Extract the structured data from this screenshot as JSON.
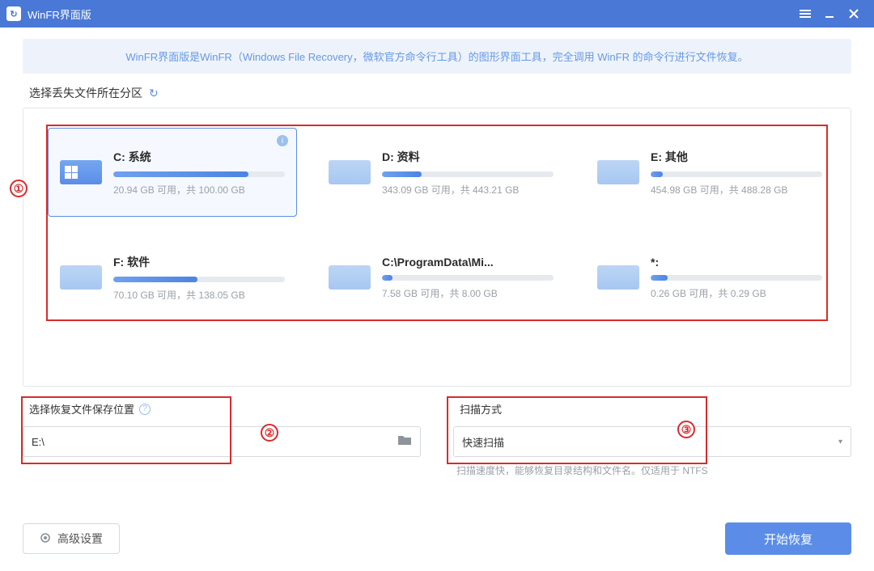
{
  "titlebar": {
    "app_name": "WinFR界面版"
  },
  "banner": {
    "text": "WinFR界面版是WinFR（Windows File Recovery，微软官方命令行工具）的图形界面工具，完全调用 WinFR 的命令行进行文件恢复。"
  },
  "section": {
    "select_partition_label": "选择丢失文件所在分区"
  },
  "drives": [
    {
      "name": "C: 系统",
      "stats": "20.94 GB 可用，共 100.00 GB",
      "fill_pct": 79,
      "selected": true,
      "system": true
    },
    {
      "name": "D: 资料",
      "stats": "343.09 GB 可用，共 443.21 GB",
      "fill_pct": 23,
      "selected": false,
      "system": false
    },
    {
      "name": "E: 其他",
      "stats": "454.98 GB 可用，共 488.28 GB",
      "fill_pct": 7,
      "selected": false,
      "system": false
    },
    {
      "name": "F: 软件",
      "stats": "70.10 GB 可用，共 138.05 GB",
      "fill_pct": 49,
      "selected": false,
      "system": false
    },
    {
      "name": "C:\\ProgramData\\Mi...",
      "stats": "7.58 GB 可用，共 8.00 GB",
      "fill_pct": 6,
      "selected": false,
      "system": false
    },
    {
      "name": "*:",
      "stats": "0.26 GB 可用，共 0.29 GB",
      "fill_pct": 10,
      "selected": false,
      "system": false
    }
  ],
  "save_location": {
    "label": "选择恢复文件保存位置",
    "value": "E:\\"
  },
  "scan_mode": {
    "label": "扫描方式",
    "value": "快速扫描",
    "helper": "扫描速度快，能够恢复目录结构和文件名。仅适用于 NTFS"
  },
  "footer": {
    "advanced": "高级设置",
    "start": "开始恢复"
  },
  "annotations": {
    "n1": "①",
    "n2": "②",
    "n3": "③"
  }
}
